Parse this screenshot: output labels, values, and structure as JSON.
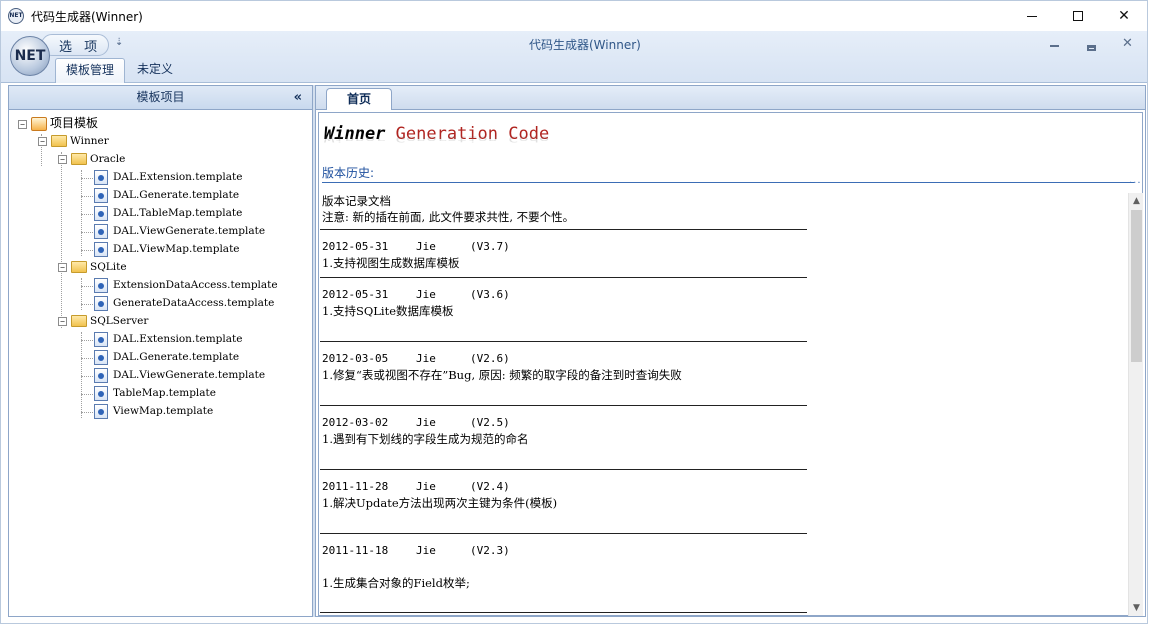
{
  "window": {
    "title": "代码生成器(Winner)",
    "app_icon_text": "NET"
  },
  "ribbon": {
    "orb_text": "NET",
    "quick_access_label": "选 项",
    "quick_access_dropdown": "⇣",
    "title": "代码生成器(Winner)",
    "close_glyph": "✕",
    "tabs": [
      {
        "label": "模板管理",
        "active": true
      },
      {
        "label": "未定义",
        "active": false
      }
    ]
  },
  "left_panel": {
    "header": "模板项目",
    "collapse_glyph": "«",
    "tree": {
      "root": "项目模板",
      "project": "Winner",
      "groups": [
        {
          "name": "Oracle",
          "files": [
            "DAL.Extension.template",
            "DAL.Generate.template",
            "DAL.TableMap.template",
            "DAL.ViewGenerate.template",
            "DAL.ViewMap.template"
          ]
        },
        {
          "name": "SQLite",
          "files": [
            "ExtensionDataAccess.template",
            "GenerateDataAccess.template"
          ]
        },
        {
          "name": "SQLServer",
          "files": [
            "DAL.Extension.template",
            "DAL.Generate.template",
            "DAL.ViewGenerate.template",
            "TableMap.template",
            "ViewMap.template"
          ]
        }
      ]
    }
  },
  "document": {
    "tab": "首页",
    "brand_word1": "Winner",
    "brand_word2": "Generation Code",
    "history_label": "版本历史:",
    "history_dots": "...",
    "intro": [
      "版本记录文档",
      "注意: 新的插在前面, 此文件要求共性, 不要个性。"
    ],
    "entries": [
      {
        "date": "2012-05-31",
        "author": "Jie",
        "version": "(V3.7)",
        "note": "1.支持视图生成数据库模板"
      },
      {
        "date": "2012-05-31",
        "author": "Jie",
        "version": "(V3.6)",
        "note": "1.支持SQLite数据库模板"
      },
      {
        "date": "2012-03-05",
        "author": "Jie",
        "version": "(V2.6)",
        "note": "1.修复“表或视图不存在”Bug, 原因: 频繁的取字段的备注到时查询失败"
      },
      {
        "date": "2012-03-02",
        "author": "Jie",
        "version": "(V2.5)",
        "note": "1.遇到有下划线的字段生成为规范的命名"
      },
      {
        "date": "2011-11-28",
        "author": "Jie",
        "version": "(V2.4)",
        "note": "1.解决Update方法出现两次主键为条件(模板)"
      },
      {
        "date": "2011-11-18",
        "author": "Jie",
        "version": "(V2.3)",
        "note": "1.生成集合对象的Field枚举;"
      }
    ]
  }
}
